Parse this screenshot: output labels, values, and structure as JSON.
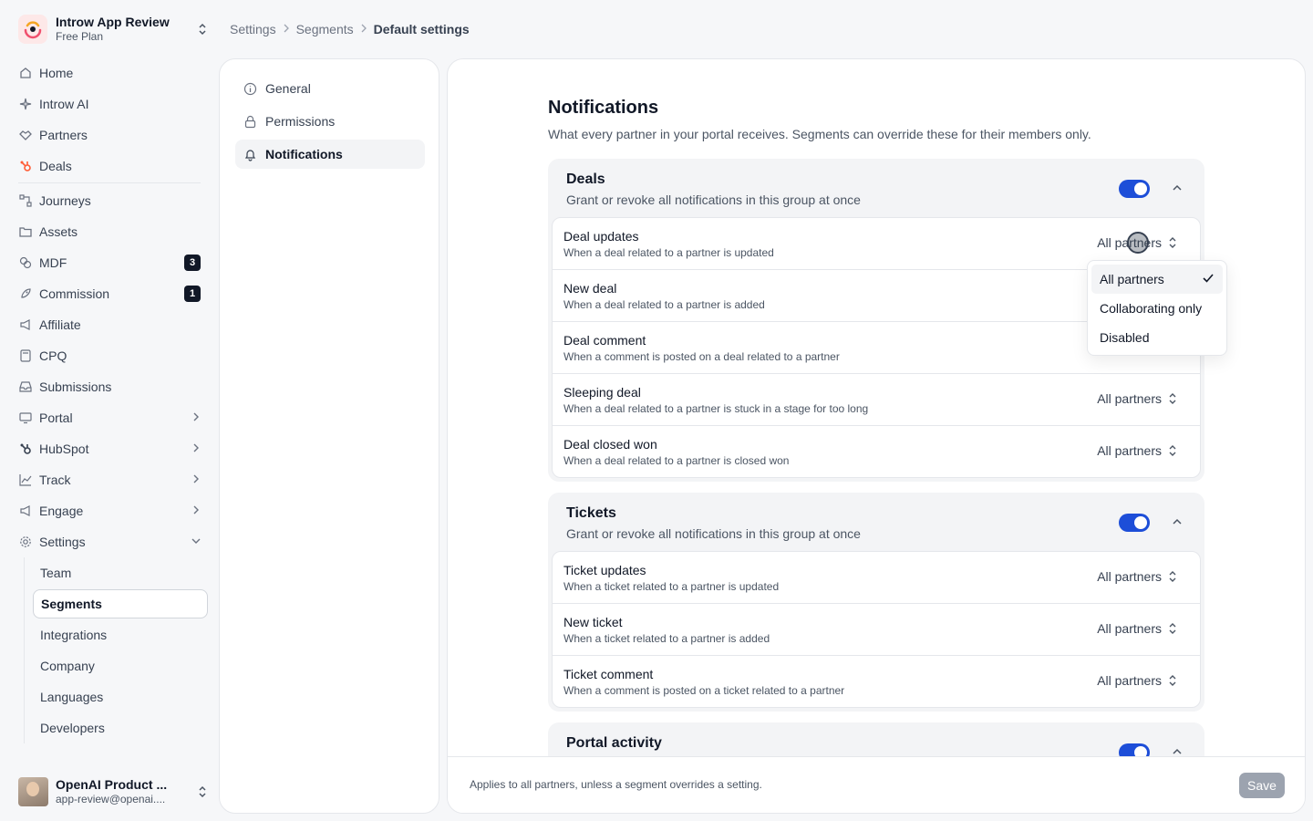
{
  "org": {
    "name": "Introw App Review",
    "plan": "Free Plan"
  },
  "nav": {
    "home": "Home",
    "introw_ai": "Introw AI",
    "partners": "Partners",
    "deals": "Deals",
    "journeys": "Journeys",
    "assets": "Assets",
    "mdf": "MDF",
    "mdf_badge": "3",
    "commission": "Commission",
    "commission_badge": "1",
    "affiliate": "Affiliate",
    "cpq": "CPQ",
    "submissions": "Submissions",
    "portal": "Portal",
    "hubspot": "HubSpot",
    "track": "Track",
    "engage": "Engage",
    "settings": "Settings",
    "settings_sub": [
      "Team",
      "Segments",
      "Integrations",
      "Company",
      "Languages",
      "Developers"
    ]
  },
  "user": {
    "name": "OpenAI Product ...",
    "email": "app-review@openai...."
  },
  "breadcrumb": [
    "Settings",
    "Segments",
    "Default settings"
  ],
  "subnav": [
    "General",
    "Permissions",
    "Notifications"
  ],
  "page": {
    "title": "Notifications",
    "description": "What every partner in your portal receives. Segments can override these for their members only."
  },
  "group_subtitle": "Grant or revoke all notifications in this group at once",
  "groups": [
    {
      "title": "Deals",
      "enabled": true,
      "rows": [
        {
          "title": "Deal updates",
          "desc": "When a deal related to a partner is updated",
          "value": "All partners"
        },
        {
          "title": "New deal",
          "desc": "When a deal related to a partner is added",
          "value": ""
        },
        {
          "title": "Deal comment",
          "desc": "When a comment is posted on a deal related to a partner",
          "value": ""
        },
        {
          "title": "Sleeping deal",
          "desc": "When a deal related to a partner is stuck in a stage for too long",
          "value": "All partners"
        },
        {
          "title": "Deal closed won",
          "desc": "When a deal related to a partner is closed won",
          "value": "All partners"
        }
      ]
    },
    {
      "title": "Tickets",
      "enabled": true,
      "rows": [
        {
          "title": "Ticket updates",
          "desc": "When a ticket related to a partner is updated",
          "value": "All partners"
        },
        {
          "title": "New ticket",
          "desc": "When a ticket related to a partner is added",
          "value": "All partners"
        },
        {
          "title": "Ticket comment",
          "desc": "When a comment is posted on a ticket related to a partner",
          "value": "All partners"
        }
      ]
    },
    {
      "title": "Portal activity",
      "enabled": true
    }
  ],
  "footer": {
    "text": "Applies to all partners, unless a segment overrides a setting.",
    "save": "Save"
  },
  "dropdown": {
    "options": [
      "All partners",
      "Collaborating only",
      "Disabled"
    ],
    "selected": "All partners"
  },
  "colors": {
    "accent": "#1d4ed8",
    "hubspot": "#ff5c35",
    "logo": "#f0506e"
  }
}
